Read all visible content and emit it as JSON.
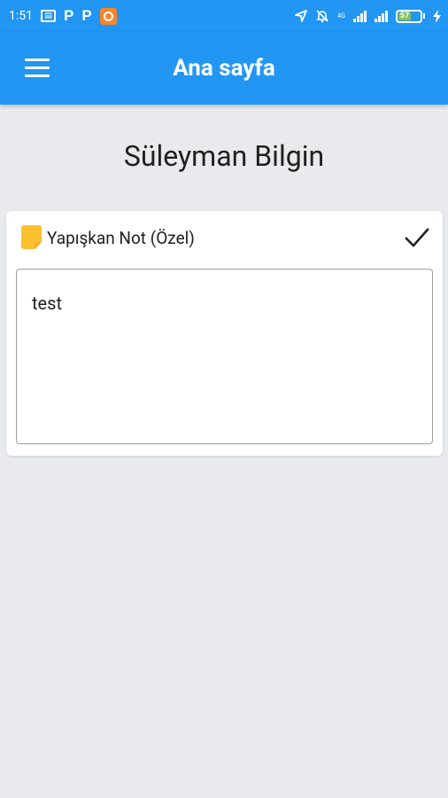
{
  "status_bar": {
    "time": "1:51",
    "net_label": "4G",
    "battery_level": "57"
  },
  "app_bar": {
    "title": "Ana sayfa",
    "menu_icon": "hamburger-menu-icon"
  },
  "profile": {
    "name": "Süleyman Bilgin"
  },
  "note": {
    "icon": "sticky-note-icon",
    "title": "Yapışkan Not (Özel)",
    "confirm_icon": "check-icon",
    "content": "test"
  },
  "colors": {
    "primary": "#2196f3",
    "background": "#e8eaed",
    "note_icon": "#fbc02d",
    "battery": "#8bc34a"
  }
}
